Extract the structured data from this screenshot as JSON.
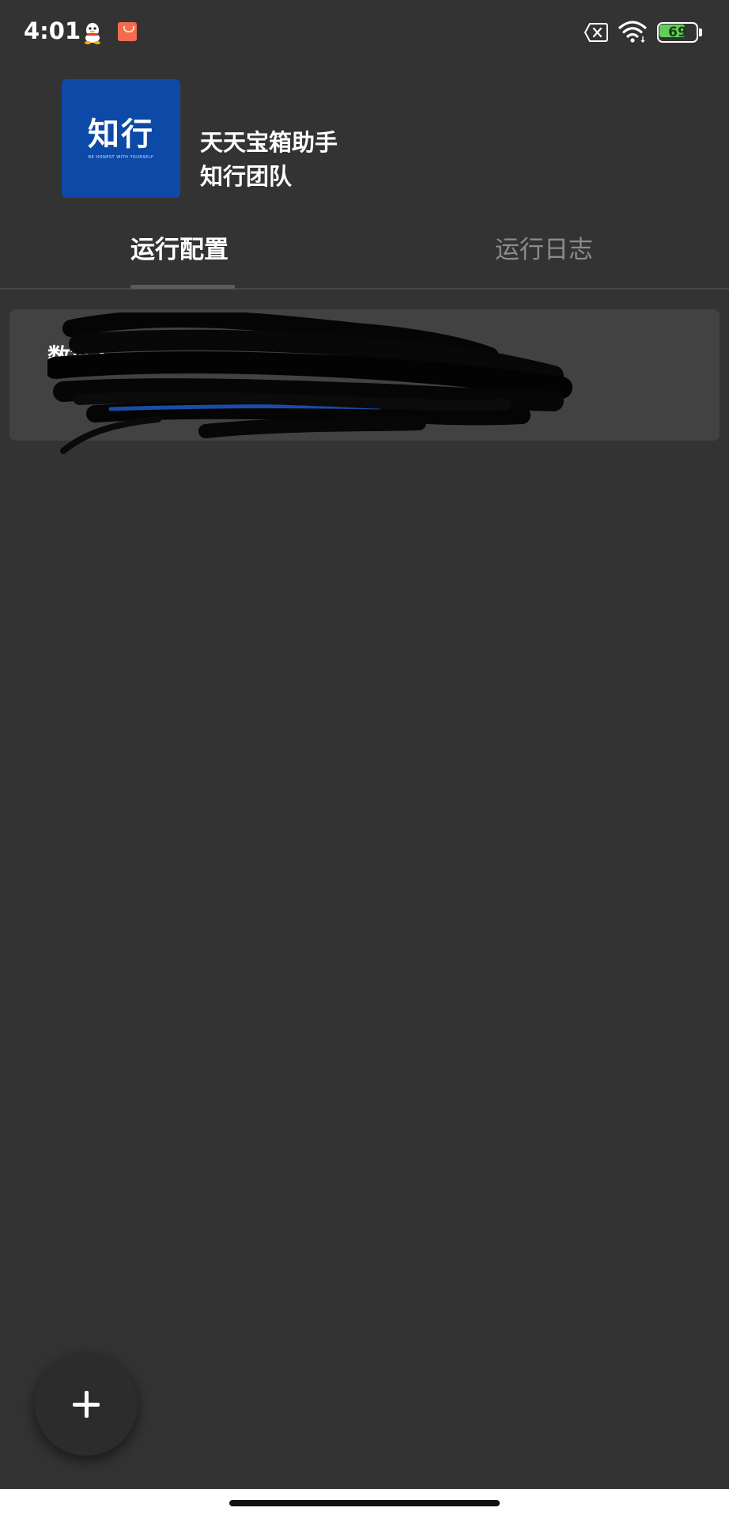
{
  "status_bar": {
    "time": "4:01",
    "battery_level": "69",
    "battery_fraction": 0.69,
    "icons": [
      "qq-icon",
      "shopping-bag-icon",
      "no-sim-icon",
      "wifi-icon",
      "battery-icon"
    ]
  },
  "header": {
    "logo_text": "知行",
    "logo_subtext": "BE HONEST WITH YOURSELF",
    "app_title": "天天宝箱助手",
    "team_name": "知行团队"
  },
  "tabs": [
    {
      "label": "运行配置",
      "active": true
    },
    {
      "label": "运行日志",
      "active": false
    }
  ],
  "cards": [
    {
      "title": "数据1"
    }
  ],
  "fab": {
    "icon": "plus-icon"
  },
  "colors": {
    "background": "#333333",
    "card": "#424242",
    "logo_blue": "#0d4aa8",
    "battery_green": "#5fcf5a"
  }
}
